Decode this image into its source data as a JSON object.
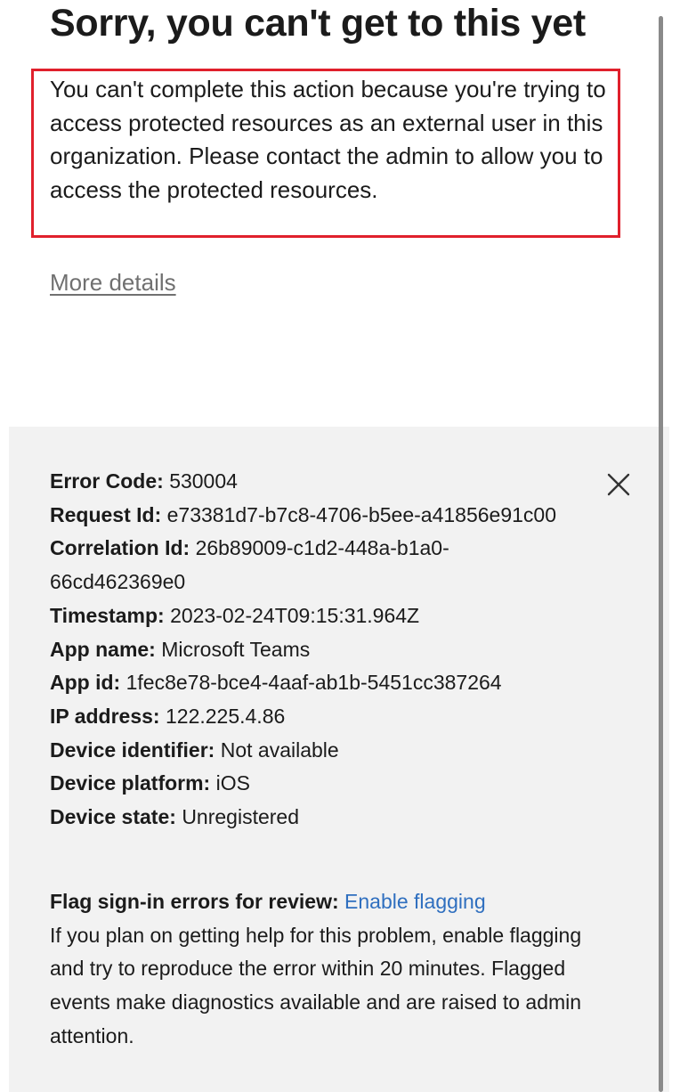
{
  "title": "Sorry, you can't get to this yet",
  "message": "You can't complete this action because you're trying to access protected resources as an external user in this organization. Please contact the admin to allow you to access the protected resources.",
  "more_details_label": "More details",
  "details": [
    {
      "label": "Error Code:",
      "value": "530004"
    },
    {
      "label": "Request Id:",
      "value": "e73381d7-b7c8-4706-b5ee-a41856e91c00"
    },
    {
      "label": "Correlation Id:",
      "value": "26b89009-c1d2-448a-b1a0-66cd462369e0"
    },
    {
      "label": "Timestamp:",
      "value": "2023-02-24T09:15:31.964Z"
    },
    {
      "label": "App name:",
      "value": "Microsoft Teams"
    },
    {
      "label": "App id:",
      "value": "1fec8e78-bce4-4aaf-ab1b-5451cc387264"
    },
    {
      "label": "IP address:",
      "value": "122.225.4.86"
    },
    {
      "label": "Device identifier:",
      "value": "Not available"
    },
    {
      "label": "Device platform:",
      "value": "iOS"
    },
    {
      "label": "Device state:",
      "value": "Unregistered"
    }
  ],
  "flag": {
    "label": "Flag sign-in errors for review:",
    "link_text": "Enable flagging",
    "description": "If you plan on getting help for this problem, enable flagging and try to reproduce the error within 20 minutes. Flagged events make diagnostics available and are raised to admin attention."
  },
  "icons": {
    "close": "close-icon"
  },
  "colors": {
    "highlight_border": "#e0202c",
    "link": "#2f6fbf",
    "panel_bg": "#f2f2f2"
  }
}
